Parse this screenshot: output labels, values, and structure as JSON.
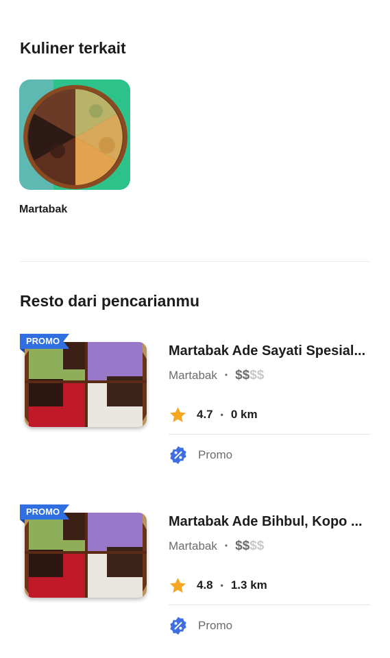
{
  "kuliner": {
    "title": "Kuliner terkait",
    "items": [
      {
        "label": "Martabak"
      }
    ]
  },
  "resto": {
    "title": "Resto dari pencarianmu",
    "items": [
      {
        "badge": "PROMO",
        "name": "Martabak Ade Sayati Spesial...",
        "category": "Martabak",
        "price_on": "$$",
        "price_off": "$$",
        "rating": "4.7",
        "distance": "0 km",
        "promo_label": "Promo"
      },
      {
        "badge": "PROMO",
        "name": "Martabak Ade Bihbul, Kopo ...",
        "category": "Martabak",
        "price_on": "$$",
        "price_off": "$$",
        "rating": "4.8",
        "distance": "1.3 km",
        "promo_label": "Promo"
      }
    ]
  },
  "colors": {
    "promo_badge": "#2f6fe0",
    "promo_icon": "#3d6fe0",
    "star": "#f5a623",
    "price_active": "#6b6b6b",
    "price_inactive": "#c8c8c8"
  },
  "icons": {
    "star": "star-icon",
    "promo": "promo-percent-icon"
  }
}
